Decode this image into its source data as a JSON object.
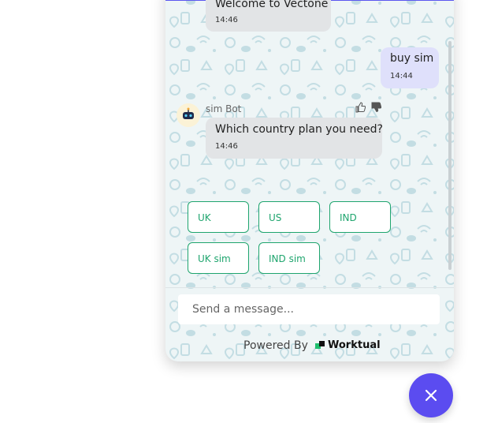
{
  "colors": {
    "accent": "#5b4cf0",
    "quick_reply": "#1fa56e",
    "bot_bubble": "#e2e4e6",
    "user_bubble": "#dfe0fb",
    "pattern_icons": "#c3dde3"
  },
  "messages": [
    {
      "sender": "bot",
      "text": "Welcome to Vectone",
      "time": "14:46"
    },
    {
      "sender": "user",
      "text": "buy sim",
      "time": "14:44"
    },
    {
      "sender": "bot",
      "text": "Which country plan you need?",
      "time": "14:46"
    }
  ],
  "bot": {
    "name": "sim Bot",
    "avatar_icon": "robot-icon"
  },
  "feedback_icons": [
    "thumbs-up-icon",
    "thumbs-down-icon"
  ],
  "quick_replies": [
    "UK",
    "US",
    "IND",
    "UK sim",
    "IND sim"
  ],
  "composer": {
    "placeholder": "Send a message..."
  },
  "footer": {
    "powered_by": "Powered By",
    "brand": "Worktual"
  },
  "close_button": {
    "icon": "close-icon"
  }
}
